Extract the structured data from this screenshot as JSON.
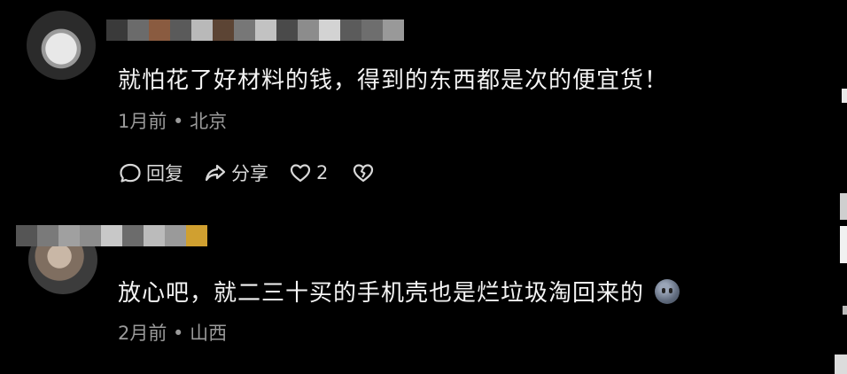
{
  "comments": [
    {
      "text": "就怕花了好材料的钱，得到的东西都是次的便宜货！",
      "meta": "1月前 • 北京",
      "actions": {
        "reply_label": "回复",
        "share_label": "分享",
        "like_count": "2"
      },
      "username_blur_colors": [
        "#3a3a3a",
        "#6b6b6b",
        "#8a5b40",
        "#5a5a5a",
        "#b9b9b9",
        "#5c4434",
        "#777777",
        "#c2c2c2",
        "#4a4a4a",
        "#8c8c8c",
        "#d3d3d3",
        "#5b5b5b",
        "#6e6e6e",
        "#999999"
      ],
      "avatar_icon": "avatar-image"
    },
    {
      "text": "放心吧，就二三十买的手机壳也是烂垃圾淘回来的",
      "meta": "2月前 • 山西",
      "emoji_icon": "emoji-face-icon",
      "username_blur_colors": [
        "#555555",
        "#7a7a7a",
        "#a0a0a0",
        "#8d8d8d",
        "#c8c8c8",
        "#6c6c6c",
        "#bbbbbb",
        "#9a9a9a",
        "#d0a030"
      ],
      "avatar_icon": "avatar-image"
    }
  ],
  "icons": {
    "reply": "comment-bubble-icon",
    "share": "share-arrow-icon",
    "like": "heart-icon",
    "dislike": "broken-heart-icon"
  },
  "colors": {
    "background": "#000000",
    "text": "#f4f4f4",
    "meta": "#9a9a9a",
    "action": "#d8d8d8"
  }
}
